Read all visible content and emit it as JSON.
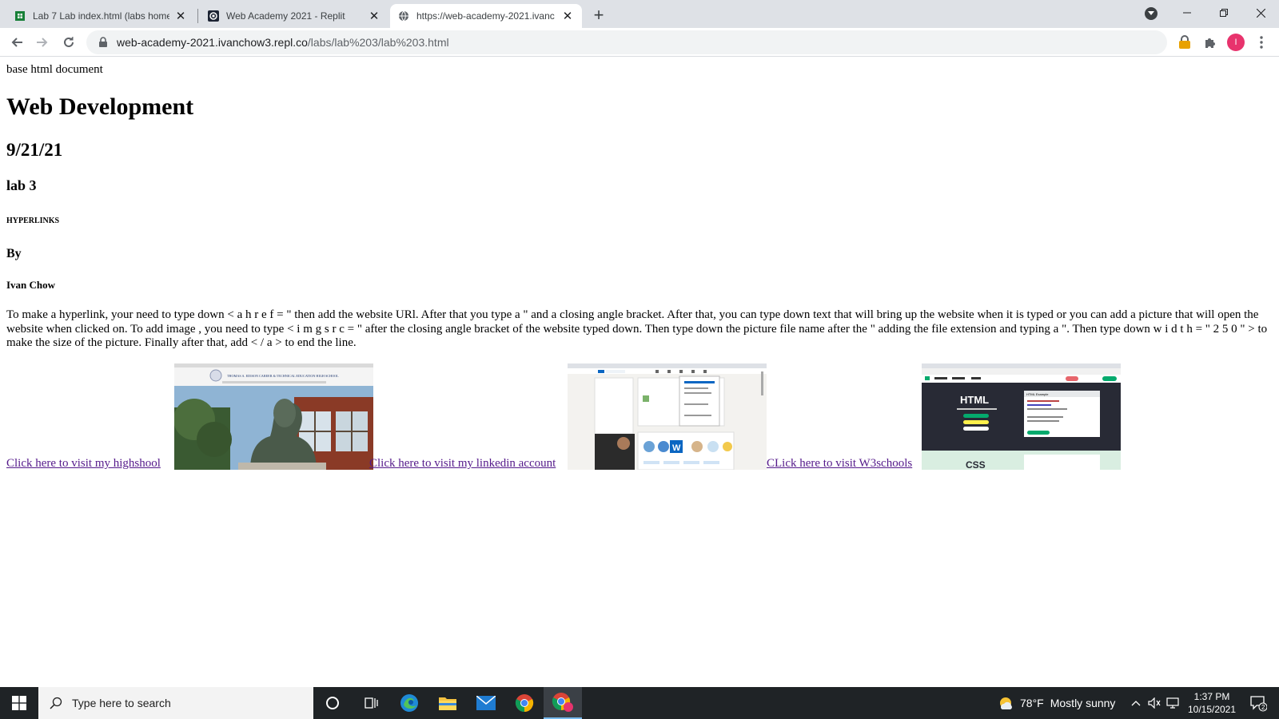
{
  "browser": {
    "tabs": [
      {
        "label": "Lab 7 Lab index.html (labs homep",
        "favicon": "green-sheet-icon"
      },
      {
        "label": "Web Academy 2021 - Replit",
        "favicon": "replit-icon"
      },
      {
        "label": "https://web-academy-2021.ivanc",
        "favicon": "globe-icon"
      }
    ],
    "url_host": "web-academy-2021.ivanchow3.repl.co",
    "url_path": "/labs/lab%203/lab%203.html",
    "profile_initial": "I"
  },
  "page": {
    "top_text": "base html document",
    "h1": "Web Development",
    "h2": "9/21/21",
    "h3": "lab 3",
    "h6": "HYPERLINKS",
    "h4": "By",
    "h5": "Ivan Chow",
    "paragraph": "To make a hyperlink, your need to type down < a h r e f = \" then add the website URl. After that you type a \" and a closing angle bracket. After that, you can type down text that will bring up the website when it is typed or you can add a picture that will open the website when clicked on. To add image , you need to type < i m g s r c = \" after the closing angle bracket of the website typed down. Then type down the picture file name after the \" adding the file extension and typing a \". Then type down w i d t h = \" 2 5 0 \" > to make the size of the picture. Finally after that, add < / a > to end the line.",
    "links": [
      {
        "text": "Click here to visit my highshool "
      },
      {
        "text": "Click here to visit my linkedin account "
      },
      {
        "text": "CLick here to visit W3schools "
      }
    ],
    "thumbnails": {
      "school_header": "THOMAS A. EDISON CAREER & TECHNICAL EDUCATION HIGH SCHOOL",
      "w3_html": "HTML",
      "w3_css": "CSS",
      "w3_example": "HTML Example"
    },
    "link_color": "#551a8b"
  },
  "taskbar": {
    "search_placeholder": "Type here to search",
    "weather_temp": "78°F",
    "weather_desc": "Mostly sunny",
    "time": "1:37 PM",
    "date": "10/15/2021",
    "notification_count": "2"
  }
}
